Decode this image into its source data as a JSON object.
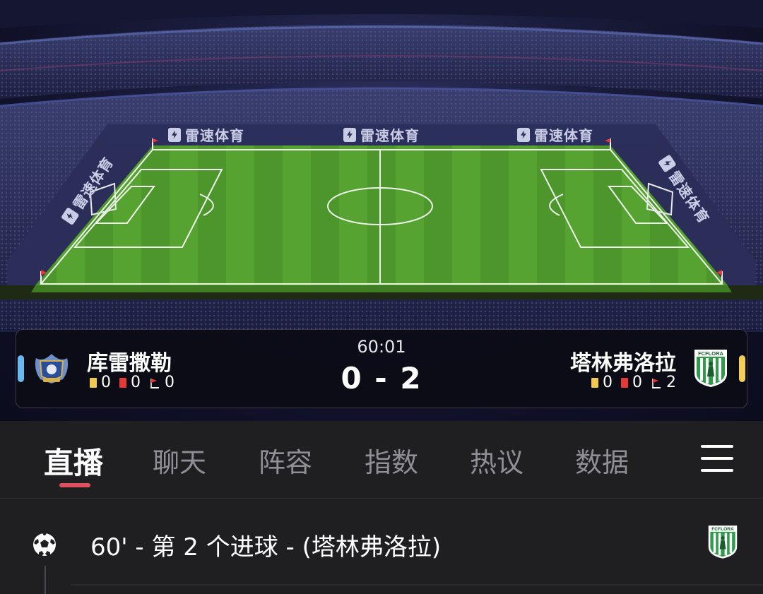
{
  "stadium": {
    "brand_text": "雷速体育"
  },
  "match": {
    "time": "60:01",
    "score": "0 - 2",
    "home": {
      "name": "库雷撒勒",
      "yellow_cards": "0",
      "red_cards": "0",
      "corners": "0",
      "color": "#6ab8f0"
    },
    "away": {
      "name": "塔林弗洛拉",
      "badge_text": "FCFLORA",
      "yellow_cards": "0",
      "red_cards": "0",
      "corners": "2",
      "color": "#f2cd5a"
    }
  },
  "tabs": {
    "items": [
      {
        "label": "直播",
        "active": true
      },
      {
        "label": "聊天"
      },
      {
        "label": "阵容"
      },
      {
        "label": "指数"
      },
      {
        "label": "热议"
      },
      {
        "label": "数据"
      }
    ],
    "menu_icon": "hamburger-menu-icon",
    "accent": "#e0505e"
  },
  "events": [
    {
      "text": "60' - 第 2 个进球 - (塔林弗洛拉)",
      "icon": "soccer-ball-icon",
      "team_badge_text": "FCFLORA"
    }
  ]
}
